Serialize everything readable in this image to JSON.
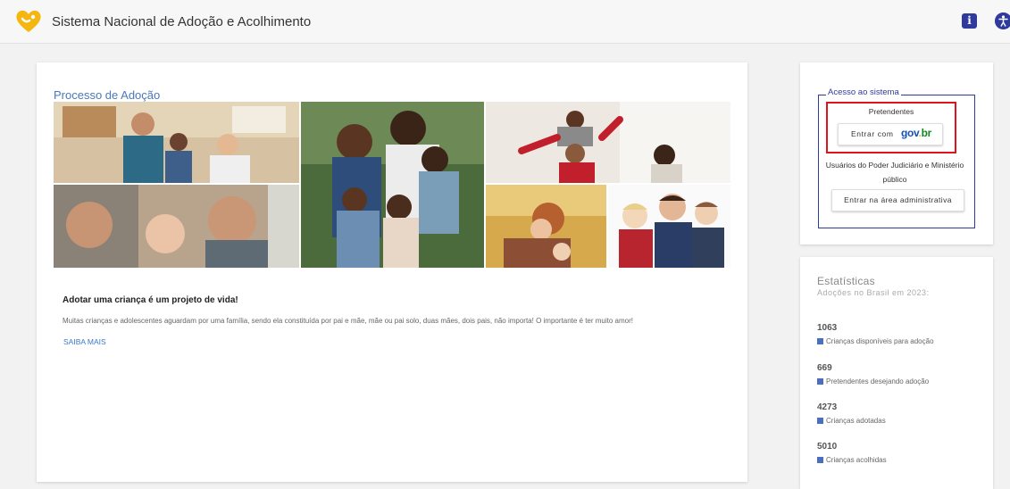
{
  "header": {
    "title": "Sistema Nacional de Adoção e Acolhimento",
    "info_icon_glyph": "i",
    "brand_color": "#f5b70f"
  },
  "main": {
    "section_title": "Processo de Adoção",
    "intro_heading": "Adotar uma criança é um projeto de vida!",
    "intro_text": "Muitas crianças e adolescentes aguardam por uma família, sendo ela constituída por pai e mãe, mãe ou pai solo, duas mães, dois pais, não importa! O importante é ter muito amor!",
    "saiba_mais": "SAIBA MAIS"
  },
  "access": {
    "legend": "Acesso ao sistema",
    "pretendentes_label": "Pretendentes",
    "gov_button_label": "Entrar com",
    "gov_logo": {
      "go": "gov",
      "dot": ".",
      "br": "br"
    },
    "users_label": "Usuários do Poder Judiciário e Ministério público",
    "admin_button_label": "Entrar na área administrativa"
  },
  "stats": {
    "title": "Estatísticas",
    "subtitle": "Adoções no Brasil em 2023:",
    "items": [
      {
        "value": "1063",
        "label": "Crianças disponíveis para adoção"
      },
      {
        "value": "669",
        "label": "Pretendentes desejando adoção"
      },
      {
        "value": "4273",
        "label": "Crianças adotadas"
      },
      {
        "value": "5010",
        "label": "Crianças acolhidas"
      }
    ]
  },
  "colors": {
    "accent_blue": "#2f3b9c",
    "highlight_red": "#e0121b",
    "link_blue": "#3c78c8"
  }
}
